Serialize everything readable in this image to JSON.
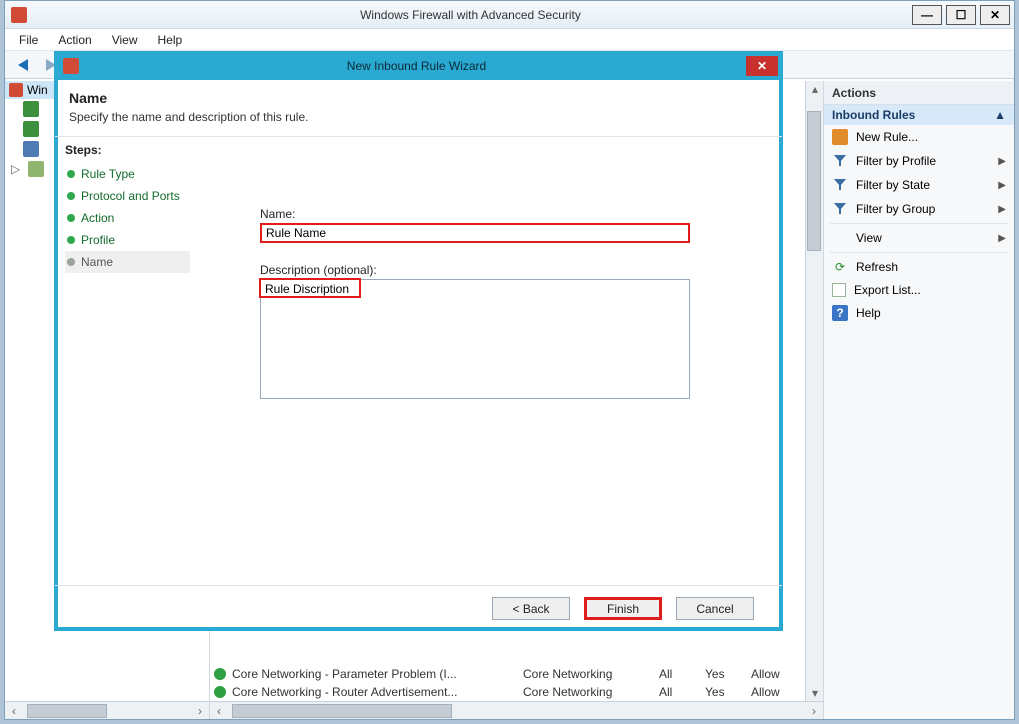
{
  "window": {
    "title": "Windows Firewall with Advanced Security",
    "menus": {
      "file": "File",
      "action": "Action",
      "view": "View",
      "help": "Help"
    }
  },
  "tree": {
    "root_label": "Win"
  },
  "rules": [
    {
      "name": "Core Networking - Parameter Problem (I...",
      "group": "Core Networking",
      "profile": "All",
      "enabled": "Yes",
      "action": "Allow"
    },
    {
      "name": "Core Networking - Router Advertisement...",
      "group": "Core Networking",
      "profile": "All",
      "enabled": "Yes",
      "action": "Allow"
    }
  ],
  "actions": {
    "header": "Actions",
    "section": "Inbound Rules",
    "items": {
      "new_rule": "New Rule...",
      "filter_profile": "Filter by Profile",
      "filter_state": "Filter by State",
      "filter_group": "Filter by Group",
      "view": "View",
      "refresh": "Refresh",
      "export": "Export List...",
      "help": "Help"
    }
  },
  "wizard": {
    "title": "New Inbound Rule Wizard",
    "heading": "Name",
    "sub": "Specify the name and description of this rule.",
    "steps_label": "Steps:",
    "steps": {
      "rule_type": "Rule Type",
      "protocol": "Protocol and Ports",
      "action": "Action",
      "profile": "Profile",
      "name": "Name"
    },
    "form": {
      "name_label": "Name:",
      "name_value": "Rule Name",
      "desc_label": "Description (optional):",
      "desc_value": "Rule Discription"
    },
    "buttons": {
      "back": "< Back",
      "finish": "Finish",
      "cancel": "Cancel"
    }
  }
}
